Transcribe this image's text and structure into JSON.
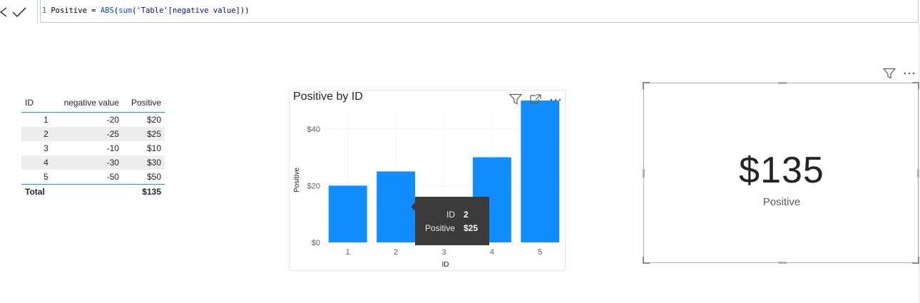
{
  "formula": {
    "line_number": "1",
    "measure_name": "Positive",
    "equals": " = ",
    "fn_abs": "ABS",
    "open1": "(",
    "fn_sum": "sum",
    "open2": "(",
    "column_ref": "'Table'[negative value]",
    "close": "))"
  },
  "table": {
    "columns": [
      "ID",
      "negative value",
      "Positive"
    ],
    "rows": [
      [
        "1",
        "-20",
        "$20"
      ],
      [
        "2",
        "-25",
        "$25"
      ],
      [
        "3",
        "-10",
        "$10"
      ],
      [
        "4",
        "-30",
        "$30"
      ],
      [
        "5",
        "-50",
        "$50"
      ]
    ],
    "total_label": "Total",
    "total_value": "$135"
  },
  "chart": {
    "title": "Positive by ID",
    "bar_color": "#118dff"
  },
  "chart_data": {
    "type": "bar",
    "title": "Positive by ID",
    "categories": [
      "1",
      "2",
      "3",
      "4",
      "5"
    ],
    "values": [
      20,
      25,
      10,
      30,
      50
    ],
    "xlabel": "ID",
    "ylabel": "Positive",
    "ylim": [
      0,
      50
    ],
    "yticks": [
      0,
      20,
      40
    ],
    "ytick_labels": [
      "$0",
      "$20",
      "$40"
    ],
    "grid": true
  },
  "tooltip": {
    "id_label": "ID",
    "id_value": "2",
    "positive_label": "Positive",
    "positive_value": "$25"
  },
  "card": {
    "value": "$135",
    "label": "Positive"
  },
  "icons": {
    "cancel": "close-icon",
    "commit": "check-icon",
    "filter": "filter-icon",
    "focus": "focus-mode-icon",
    "more": "more-options-icon"
  }
}
